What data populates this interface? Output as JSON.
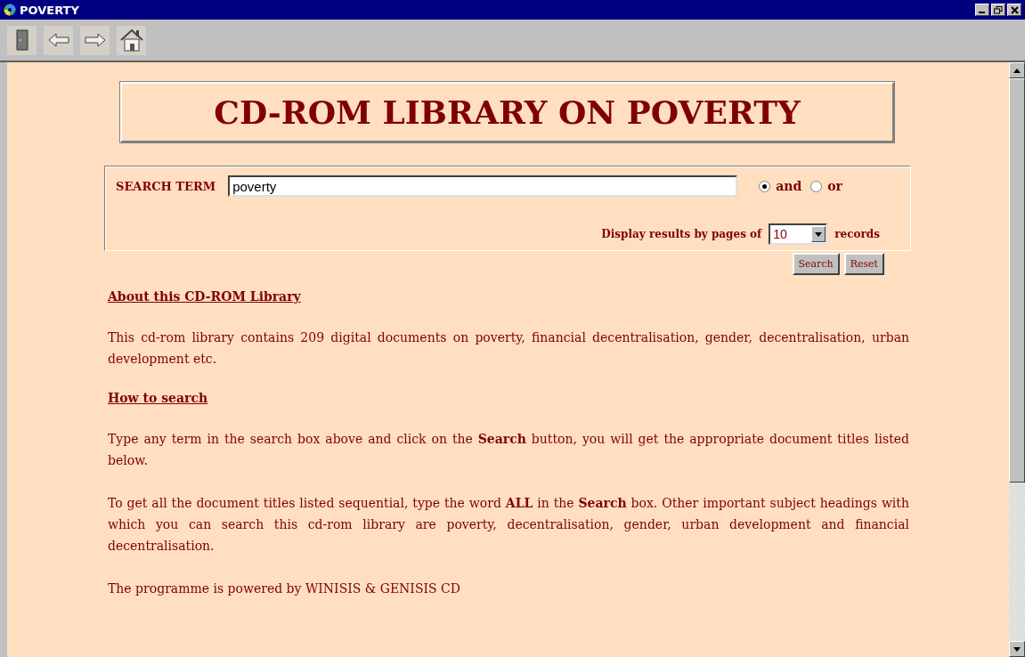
{
  "window": {
    "title": "POVERTY"
  },
  "heading": "CD-ROM LIBRARY ON POVERTY",
  "search": {
    "label": "SEARCH TERM",
    "value": "poverty",
    "modes": [
      {
        "label": "and",
        "selected": true
      },
      {
        "label": "or",
        "selected": false
      }
    ],
    "page_size_label": "Display results by pages of",
    "page_size": "10",
    "page_size_suffix": "records",
    "buttons": [
      "Search",
      "Reset"
    ]
  },
  "sections": [
    {
      "kind": "heading",
      "text": "About this CD-ROM Library"
    },
    {
      "kind": "paragraph",
      "text": "This cd-rom library contains 209 digital documents on poverty, financial decentralisation, gender, decentralisation, urban development etc."
    },
    {
      "kind": "heading",
      "text": "How to search"
    },
    {
      "kind": "paragraph",
      "text": "Type any term in the search box above and click on the **Search** button, you will get the appropriate document titles listed below."
    },
    {
      "kind": "paragraph",
      "text": "To get all the document titles listed sequential, type the word **ALL** in the **Search** box. Other important subject headings with which you can search this cd-rom library are poverty, decentralisation, gender, urban development and financial decentralisation."
    },
    {
      "kind": "paragraph",
      "text": "The programme is powered by WINISIS & GENISIS CD"
    }
  ]
}
